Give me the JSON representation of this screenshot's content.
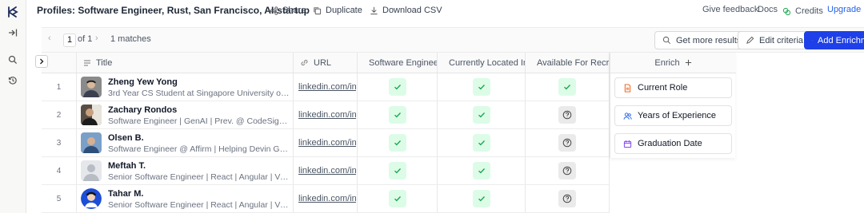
{
  "app": {
    "title": "Profiles: Software Engineer, Rust, San Francisco, AI-startup"
  },
  "header": {
    "share": "Share",
    "duplicate": "Duplicate",
    "download": "Download CSV",
    "feedback": "Give feedback",
    "docs": "Docs",
    "credits": "Credits",
    "upgrade": "Upgrade"
  },
  "toolbar": {
    "page": "1",
    "of": "of 1",
    "matches": "1 matches",
    "get_more": "Get more results",
    "edit_criteria": "Edit criteria",
    "add_enrichment": "Add Enrichm"
  },
  "columns": {
    "title": "Title",
    "url": "URL",
    "c1": "Software Engineer W",
    "c2": "Currently Located In",
    "c3": "Available For Recru"
  },
  "rows": [
    {
      "num": "1",
      "name": "Zheng Yew Yong",
      "headline": "3rd Year CS Student at Singapore University of Technol...",
      "url": "linkedin.com/in/yo",
      "c1": "check",
      "c2": "check",
      "c3": "check"
    },
    {
      "num": "2",
      "name": "Zachary Rondos",
      "headline": "Software Engineer | GenAI | Prev. @ CodeSignal | Pursu...",
      "url": "linkedin.com/in/za",
      "c1": "check",
      "c2": "check",
      "c3": "unknown"
    },
    {
      "num": "3",
      "name": "Olsen B.",
      "headline": "Software Engineer @ Affirm | Helping Devin Get Smarte...",
      "url": "linkedin.com/in/ol",
      "c1": "check",
      "c2": "check",
      "c3": "unknown"
    },
    {
      "num": "4",
      "name": "Meftah T.",
      "headline": "Senior Software Engineer | React | Angular | Vue | Node...",
      "url": "linkedin.com/in/m",
      "c1": "check",
      "c2": "check",
      "c3": "unknown"
    },
    {
      "num": "5",
      "name": "Tahar M.",
      "headline": "Senior Software Engineer | React | Angular | Vue | Node...",
      "url": "linkedin.com/in/ta",
      "c1": "check",
      "c2": "check",
      "c3": "unknown"
    }
  ],
  "enrich": {
    "header": "Enrich",
    "items": [
      "Current Role",
      "Years of Experience",
      "Graduation Date"
    ]
  },
  "colors": {
    "accent": "#1e40e8",
    "check_bg": "#dcfce7",
    "check": "#16a34a",
    "upgrade": "#2563eb"
  }
}
